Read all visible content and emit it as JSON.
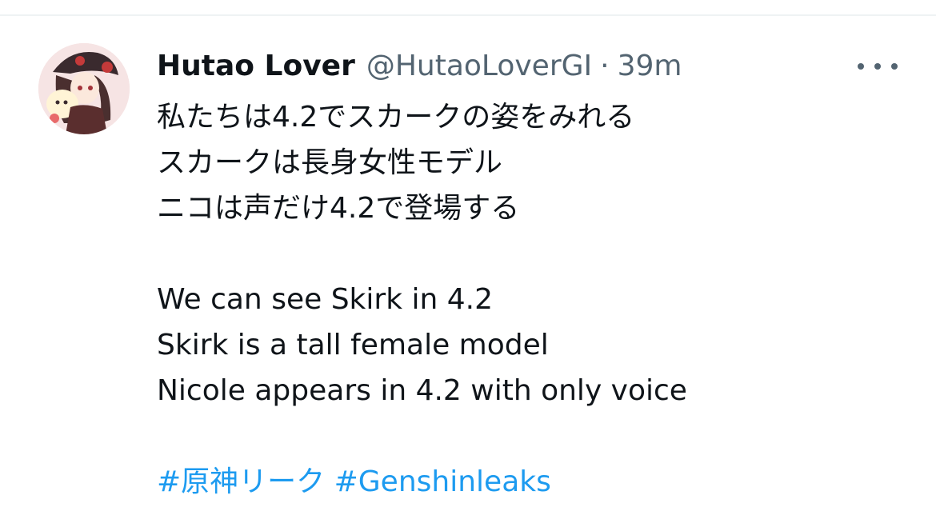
{
  "author": {
    "display_name": "Hutao Lover",
    "handle": "@HutaoLoverGI",
    "separator": "·",
    "time": "39m"
  },
  "tweet": {
    "lines": [
      "私たちは4.2でスカークの姿をみれる",
      "スカークは長身女性モデル",
      "ニコは声だけ4.2で登場する",
      "",
      "We can see Skirk in 4.2",
      "Skirk is a tall female model",
      "Nicole appears in 4.2 with only voice",
      ""
    ],
    "hashtags": [
      "#原神リーク",
      "#Genshinleaks"
    ]
  },
  "colors": {
    "text_primary": "#0f1419",
    "text_secondary": "#536471",
    "link": "#1d9bf0"
  },
  "icons": {
    "more": "more-dots-icon"
  }
}
